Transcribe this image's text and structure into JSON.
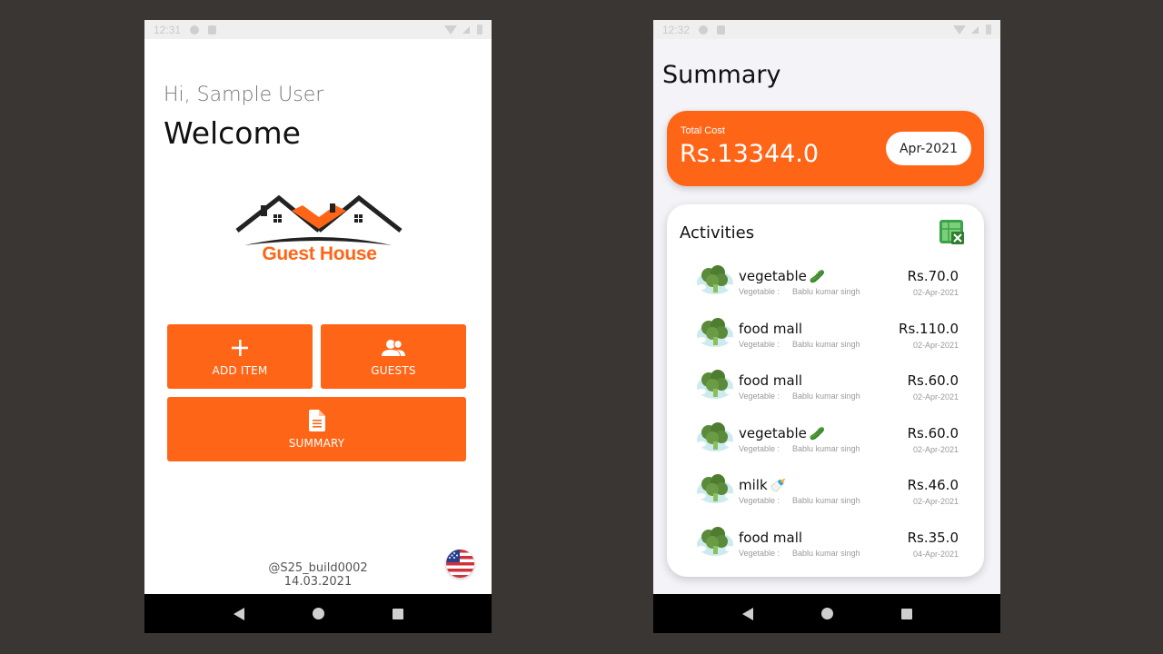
{
  "colors": {
    "accent": "#ff6517",
    "background": "#3a3633"
  },
  "home": {
    "status_time": "12:31",
    "greeting": "Hi, Sample User",
    "welcome": "Welcome",
    "logo_text": "Guest House",
    "tiles": {
      "add_item": {
        "label": "ADD ITEM",
        "icon": "plus-icon"
      },
      "guests": {
        "label": "GUESTS",
        "icon": "users-icon"
      },
      "summary": {
        "label": "SUMMARY",
        "icon": "document-icon"
      }
    },
    "build_id": "@S25_build0002",
    "build_date": "14.03.2021",
    "language_icon": "us-flag-icon"
  },
  "summary": {
    "status_time": "12:32",
    "title": "Summary",
    "total_cost_label": "Total Cost",
    "total_cost_value": "Rs.13344.0",
    "month": "Apr-2021",
    "activities_title": "Activities",
    "export_icon": "excel-icon",
    "activities": [
      {
        "name": "vegetable",
        "emoji": "🥒",
        "category": "Vegetable :",
        "person": "Bablu kumar singh",
        "amount": "Rs.70.0",
        "date": "02-Apr-2021"
      },
      {
        "name": "food mall",
        "emoji": "",
        "category": "Vegetable :",
        "person": "Bablu kumar singh",
        "amount": "Rs.110.0",
        "date": "02-Apr-2021"
      },
      {
        "name": "food mall",
        "emoji": "",
        "category": "Vegetable :",
        "person": "Bablu kumar singh",
        "amount": "Rs.60.0",
        "date": "02-Apr-2021"
      },
      {
        "name": "vegetable",
        "emoji": "🥒",
        "category": "Vegetable :",
        "person": "Bablu kumar singh",
        "amount": "Rs.60.0",
        "date": "02-Apr-2021"
      },
      {
        "name": "milk",
        "emoji": "🍼",
        "category": "Vegetable :",
        "person": "Bablu kumar singh",
        "amount": "Rs.46.0",
        "date": "02-Apr-2021"
      },
      {
        "name": "food mall",
        "emoji": "",
        "category": "Vegetable :",
        "person": "Bablu kumar singh",
        "amount": "Rs.35.0",
        "date": "04-Apr-2021"
      }
    ]
  }
}
